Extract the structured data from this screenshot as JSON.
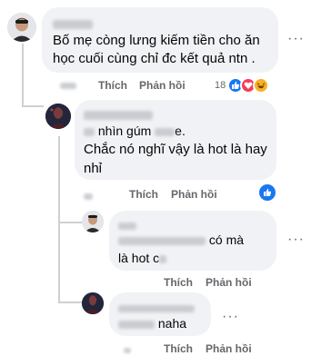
{
  "comments": [
    {
      "author": "",
      "text": "Bố mẹ còng lưng kiếm tiền cho ăn học cuối cùng chỉ đc kết quả ntn .",
      "actions": {
        "like": "Thích",
        "reply": "Phản hồi"
      },
      "reaction_count": "18",
      "reactions": [
        "like-icon",
        "love-icon",
        "haha-icon"
      ]
    },
    {
      "author": "",
      "text_line1_visible": "nhìn gúm",
      "text_line1_end": "e.",
      "text_rest": "Chắc nó nghĩ vậy là hot là hay nhỉ",
      "actions": {
        "like": "Thích",
        "reply": "Phản hồi"
      },
      "reactions": [
        "like-icon"
      ]
    },
    {
      "author": "",
      "text_visible": "có mà",
      "text_line2": "là hot c",
      "actions": {
        "like": "Thích",
        "reply": "Phản hồi"
      }
    },
    {
      "author": "",
      "text_visible": "naha",
      "actions": {
        "like": "Thích",
        "reply": "Phản hồi"
      }
    }
  ],
  "colors": {
    "bubble": "#f0f2f5",
    "muted_text": "#65676b",
    "like_blue": "#1877f2",
    "love_red": "#f33e58",
    "haha_yellow": "#f7b125"
  }
}
